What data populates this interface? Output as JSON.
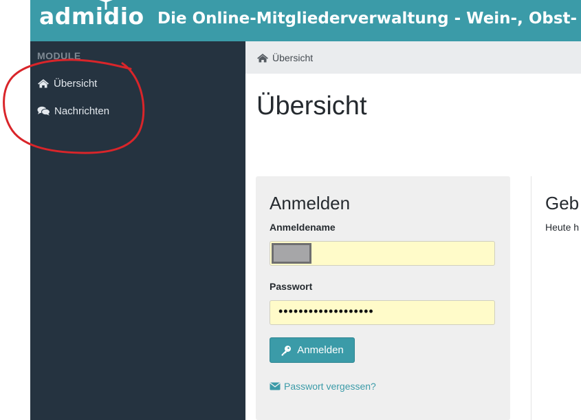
{
  "header": {
    "logo_text": "admidio",
    "title": "Die Online-Mitgliederverwaltung - Wein-, Obst-"
  },
  "sidebar": {
    "heading": "MODULE",
    "items": [
      {
        "label": "Übersicht",
        "icon": "home-icon"
      },
      {
        "label": "Nachrichten",
        "icon": "comments-icon"
      }
    ]
  },
  "breadcrumb": {
    "label": "Übersicht",
    "icon": "home-icon"
  },
  "page": {
    "title": "Übersicht"
  },
  "login": {
    "title": "Anmelden",
    "username_label": "Anmeldename",
    "password_label": "Passwort",
    "password_value": "•••••••••••••••••••",
    "button_label": "Anmelden",
    "forgot_label": "Passwort vergessen?"
  },
  "birthdays": {
    "title": "Geb",
    "text": "Heute h"
  },
  "colors": {
    "header": "#3b9ba8",
    "sidebar": "#253340",
    "input_bg": "#fffbc9",
    "annotation": "#d9252a"
  }
}
